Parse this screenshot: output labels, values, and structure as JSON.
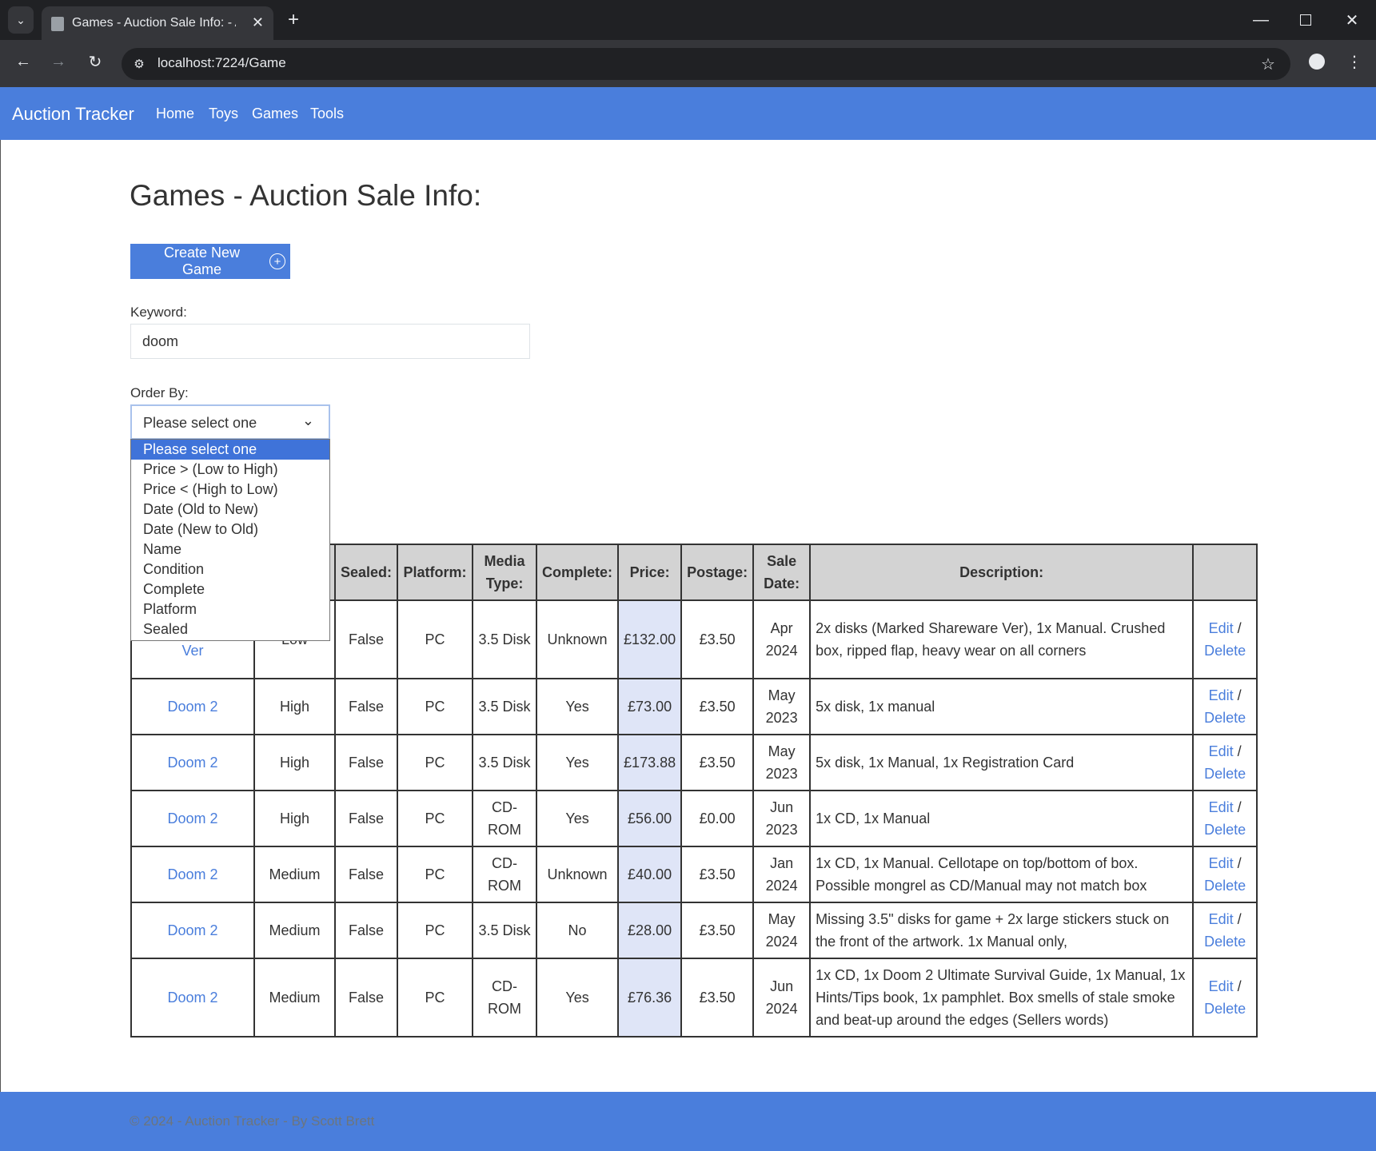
{
  "browser": {
    "tab_title": "Games - Auction Sale Info: - Au",
    "url": "localhost:7224/Game"
  },
  "navbar": {
    "brand": "Auction Tracker",
    "links": [
      "Home",
      "Toys",
      "Games",
      "Tools"
    ]
  },
  "page": {
    "title": "Games - Auction Sale Info:",
    "create_button": "Create New Game",
    "keyword_label": "Keyword:",
    "keyword_value": "doom",
    "order_label": "Order By:",
    "order_selected": "Please select one",
    "order_options": [
      "Please select one",
      "Price > (Low to High)",
      "Price < (High to Low)",
      "Date (Old to New)",
      "Date (New to Old)",
      "Name",
      "Condition",
      "Complete",
      "Platform",
      "Sealed"
    ]
  },
  "table": {
    "headers": [
      "",
      "",
      "Sealed:",
      "Platform:",
      "Media Type:",
      "Complete:",
      "Price:",
      "Postage:",
      "Sale Date:",
      "Description:",
      ""
    ],
    "rows": [
      {
        "name": "Order Shareware Ver",
        "condition": "Low",
        "sealed": "False",
        "platform": "PC",
        "media": "3.5 Disk",
        "complete": "Unknown",
        "price": "£132.00",
        "postage": "£3.50",
        "date": "Apr 2024",
        "description": "2x disks (Marked Shareware Ver), 1x Manual. Crushed box, ripped flap, heavy wear on all corners"
      },
      {
        "name": "Doom 2",
        "condition": "High",
        "sealed": "False",
        "platform": "PC",
        "media": "3.5 Disk",
        "complete": "Yes",
        "price": "£73.00",
        "postage": "£3.50",
        "date": "May 2023",
        "description": "5x disk, 1x manual"
      },
      {
        "name": "Doom 2",
        "condition": "High",
        "sealed": "False",
        "platform": "PC",
        "media": "3.5 Disk",
        "complete": "Yes",
        "price": "£173.88",
        "postage": "£3.50",
        "date": "May 2023",
        "description": "5x disk, 1x Manual, 1x Registration Card"
      },
      {
        "name": "Doom 2",
        "condition": "High",
        "sealed": "False",
        "platform": "PC",
        "media": "CD-ROM",
        "complete": "Yes",
        "price": "£56.00",
        "postage": "£0.00",
        "date": "Jun 2023",
        "description": "1x CD, 1x Manual"
      },
      {
        "name": "Doom 2",
        "condition": "Medium",
        "sealed": "False",
        "platform": "PC",
        "media": "CD-ROM",
        "complete": "Unknown",
        "price": "£40.00",
        "postage": "£3.50",
        "date": "Jan 2024",
        "description": "1x CD, 1x Manual. Cellotape on top/bottom of box. Possible mongrel as CD/Manual may not match box"
      },
      {
        "name": "Doom 2",
        "condition": "Medium",
        "sealed": "False",
        "platform": "PC",
        "media": "3.5 Disk",
        "complete": "No",
        "price": "£28.00",
        "postage": "£3.50",
        "date": "May 2024",
        "description": "Missing 3.5\" disks for game + 2x large stickers stuck on the front of the artwork. 1x Manual only,"
      },
      {
        "name": "Doom 2",
        "condition": "Medium",
        "sealed": "False",
        "platform": "PC",
        "media": "CD-ROM",
        "complete": "Yes",
        "price": "£76.36",
        "postage": "£3.50",
        "date": "Jun 2024",
        "description": "1x CD, 1x Doom 2 Ultimate Survival Guide, 1x Manual, 1x Hints/Tips book, 1x pamphlet. Box smells of stale smoke and beat-up around the edges (Sellers words)"
      }
    ],
    "edit_label": "Edit",
    "separator": "/",
    "delete_label": "Delete"
  },
  "footer": {
    "text": "© 2024 - Auction Tracker - By Scott Brett"
  },
  "colors": {
    "navbar": "#4a7edc",
    "price_cell": "#dfe5f7",
    "link": "#4a7edc"
  }
}
